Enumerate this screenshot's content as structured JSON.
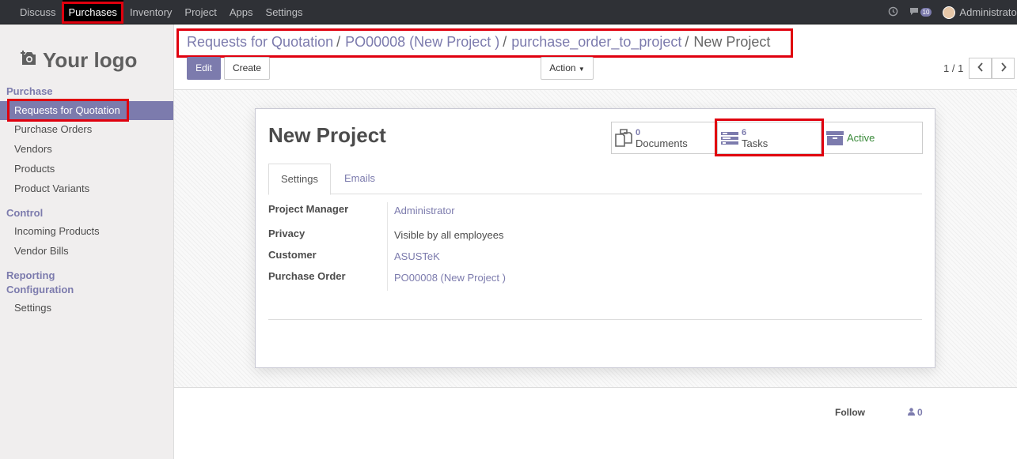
{
  "topbar": {
    "menu": [
      {
        "label": "Discuss"
      },
      {
        "label": "Purchases"
      },
      {
        "label": "Inventory"
      },
      {
        "label": "Project"
      },
      {
        "label": "Apps"
      },
      {
        "label": "Settings"
      }
    ],
    "active_menu": "Purchases",
    "chat_count": "10",
    "user_name": "Administrator"
  },
  "sidebar": {
    "logo_text": "Your logo",
    "sections": {
      "purchase": "Purchase",
      "control": "Control",
      "reporting": "Reporting",
      "configuration": "Configuration"
    },
    "items": {
      "rfq": "Requests for Quotation",
      "purchase_orders": "Purchase Orders",
      "vendors": "Vendors",
      "products": "Products",
      "product_variants": "Product Variants",
      "incoming_products": "Incoming Products",
      "vendor_bills": "Vendor Bills",
      "settings": "Settings"
    },
    "active_item": "Requests for Quotation"
  },
  "breadcrumb": {
    "items": [
      "Requests for Quotation",
      "PO00008 (New Project )",
      "purchase_order_to_project"
    ],
    "current": "New Project",
    "separator": "/"
  },
  "toolbar": {
    "edit": "Edit",
    "create": "Create",
    "action": "Action",
    "pager": "1 / 1"
  },
  "record": {
    "title": "New Project",
    "stats": {
      "documents_count": "0",
      "documents_label": "Documents",
      "tasks_count": "6",
      "tasks_label": "Tasks",
      "active_label": "Active"
    },
    "tabs": [
      "Settings",
      "Emails"
    ],
    "fields": {
      "project_manager_label": "Project Manager",
      "project_manager": "Administrator",
      "privacy_label": "Privacy",
      "privacy": "Visible by all employees",
      "customer_label": "Customer",
      "customer": "ASUSTeK",
      "purchase_order_label": "Purchase Order",
      "purchase_order": "PO00008 (New Project )"
    }
  },
  "chatter": {
    "follow": "Follow",
    "followers_count": "0"
  },
  "colors": {
    "accent": "#7c7bad",
    "highlight": "#e0000e",
    "topbar": "#2f3136"
  }
}
